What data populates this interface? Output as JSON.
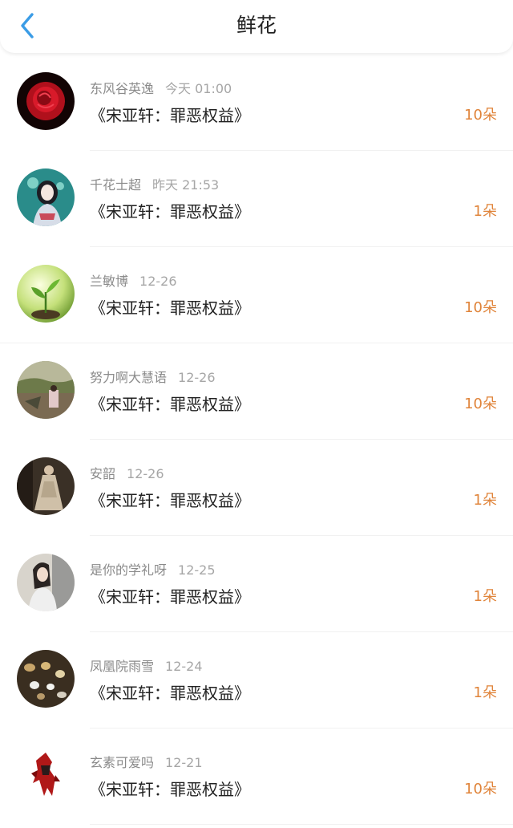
{
  "header": {
    "title": "鲜花",
    "back_icon": "chevron-left-icon",
    "accent": "#3b9ce6"
  },
  "colors": {
    "count": "#e0843a",
    "name": "#8a8a8a",
    "time": "#a6a6a6"
  },
  "items": [
    {
      "name": "东风谷英逸",
      "time": "今天 01:00",
      "content": "《宋亚轩：罪恶权益》",
      "count": "10朵",
      "avatar": "red-rose-avatar"
    },
    {
      "name": "千花士超",
      "time": "昨天 21:53",
      "content": "《宋亚轩：罪恶权益》",
      "count": "1朵",
      "avatar": "anime-girl-avatar"
    },
    {
      "name": "兰敏博",
      "time": "12-26",
      "content": "《宋亚轩：罪恶权益》",
      "count": "10朵",
      "avatar": "sprout-avatar"
    },
    {
      "name": "努力啊大慧语",
      "time": "12-26",
      "content": "《宋亚轩：罪恶权益》",
      "count": "10朵",
      "avatar": "outdoor-photo-avatar"
    },
    {
      "name": "安韶",
      "time": "12-26",
      "content": "《宋亚轩：罪恶权益》",
      "count": "1朵",
      "avatar": "dress-photo-avatar"
    },
    {
      "name": "是你的学礼呀",
      "time": "12-25",
      "content": "《宋亚轩：罪恶权益》",
      "count": "1朵",
      "avatar": "girl-photo-avatar"
    },
    {
      "name": "凤凰院雨雪",
      "time": "12-24",
      "content": "《宋亚轩：罪恶权益》",
      "count": "1朵",
      "avatar": "stones-avatar"
    },
    {
      "name": "玄素可爱吗",
      "time": "12-21",
      "content": "《宋亚轩：罪恶权益》",
      "count": "10朵",
      "avatar": "red-robot-avatar"
    }
  ]
}
